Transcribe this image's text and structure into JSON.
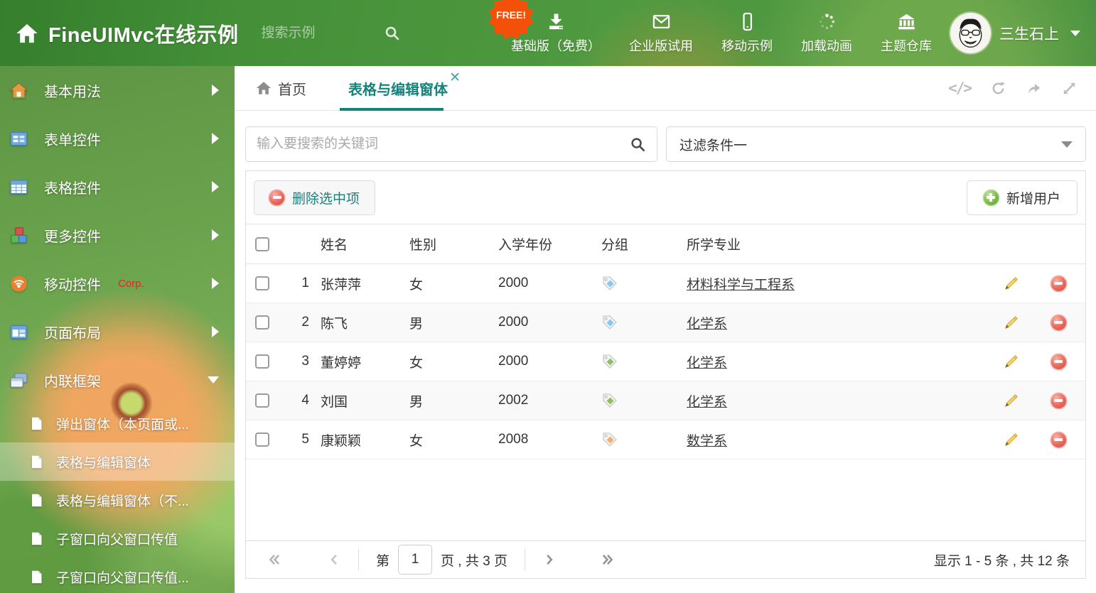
{
  "colors": {
    "accent_teal": "#15827b",
    "header_green": "#4f9a40",
    "danger_red": "#e2574c",
    "success_green": "#67b239",
    "free_badge_orange": "#f4500a",
    "tag_blue": "#87c7f3",
    "tag_green": "#8fbf63",
    "tag_orange": "#f9ad66"
  },
  "header": {
    "title": "FineUIMvc在线示例",
    "search_placeholder": "搜索示例",
    "free_badge": "FREE!",
    "nav": [
      {
        "label": "基础版（免费）",
        "icon": "download-icon"
      },
      {
        "label": "企业版试用",
        "icon": "envelope-icon"
      },
      {
        "label": "移动示例",
        "icon": "mobile-icon"
      },
      {
        "label": "加载动画",
        "icon": "spinner-icon"
      },
      {
        "label": "主题仓库",
        "icon": "bank-icon"
      }
    ],
    "user": "三生石上"
  },
  "sidebar": {
    "items": [
      {
        "label": "基本用法",
        "icon": "home-icon"
      },
      {
        "label": "表单控件",
        "icon": "form-icon"
      },
      {
        "label": "表格控件",
        "icon": "table-icon"
      },
      {
        "label": "更多控件",
        "icon": "cubes-icon"
      },
      {
        "label": "移动控件",
        "badge": "Corp.",
        "icon": "signal-icon"
      },
      {
        "label": "页面布局",
        "icon": "layout-icon"
      },
      {
        "label": "内联框架",
        "icon": "frames-icon",
        "expanded": true
      }
    ],
    "subitems": [
      {
        "label": "弹出窗体（本页面或..."
      },
      {
        "label": "表格与编辑窗体",
        "active": true
      },
      {
        "label": "表格与编辑窗体（不..."
      },
      {
        "label": "子窗口向父窗口传值"
      },
      {
        "label": "子窗口向父窗口传值..."
      }
    ]
  },
  "tabs": {
    "home_label": "首页",
    "active_label": "表格与编辑窗体"
  },
  "filters": {
    "search_placeholder": "输入要搜索的关键词",
    "filter_value": "过滤条件一"
  },
  "toolbar": {
    "delete_label": "删除选中项",
    "add_label": "新增用户"
  },
  "table": {
    "columns": [
      "姓名",
      "性别",
      "入学年份",
      "分组",
      "所学专业"
    ],
    "rows": [
      {
        "num": "1",
        "name": "张萍萍",
        "gender": "女",
        "year": "2000",
        "tag_color": "#87c7f3",
        "major": "材料科学与工程系"
      },
      {
        "num": "2",
        "name": "陈飞",
        "gender": "男",
        "year": "2000",
        "tag_color": "#87c7f3",
        "major": "化学系"
      },
      {
        "num": "3",
        "name": "董婷婷",
        "gender": "女",
        "year": "2000",
        "tag_color": "#8fbf63",
        "major": "化学系"
      },
      {
        "num": "4",
        "name": "刘国",
        "gender": "男",
        "year": "2002",
        "tag_color": "#8fbf63",
        "major": "化学系"
      },
      {
        "num": "5",
        "name": "康颖颖",
        "gender": "女",
        "year": "2008",
        "tag_color": "#f9ad66",
        "major": "数学系"
      }
    ]
  },
  "pagination": {
    "prefix": "第",
    "current": "1",
    "suffix": "页 , 共 3 页",
    "summary": "显示 1 - 5 条 , 共 12 条"
  }
}
